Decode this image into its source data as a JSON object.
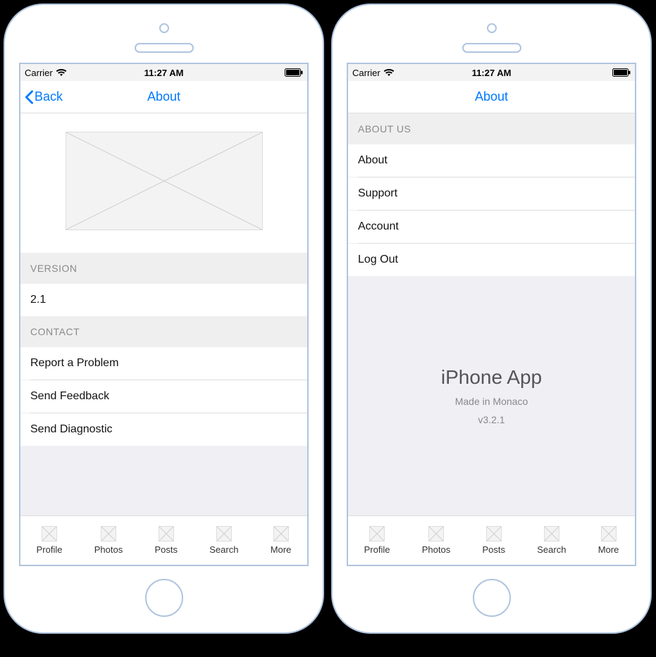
{
  "status": {
    "carrier": "Carrier",
    "time": "11:27 AM"
  },
  "left": {
    "nav": {
      "back": "Back",
      "title": "About"
    },
    "sections": {
      "version": {
        "header": "VERSION",
        "value": "2.1"
      },
      "contact": {
        "header": "CONTACT",
        "items": [
          "Report a Problem",
          "Send Feedback",
          "Send Diagnostic"
        ]
      }
    }
  },
  "right": {
    "nav": {
      "title": "About"
    },
    "sections": {
      "about_us": {
        "header": "ABOUT US",
        "items": [
          "About",
          "Support",
          "Account",
          "Log Out"
        ]
      }
    },
    "footer": {
      "title": "iPhone App",
      "subtitle": "Made in Monaco",
      "version": "v3.2.1"
    }
  },
  "tabs": [
    "Profile",
    "Photos",
    "Posts",
    "Search",
    "More"
  ]
}
